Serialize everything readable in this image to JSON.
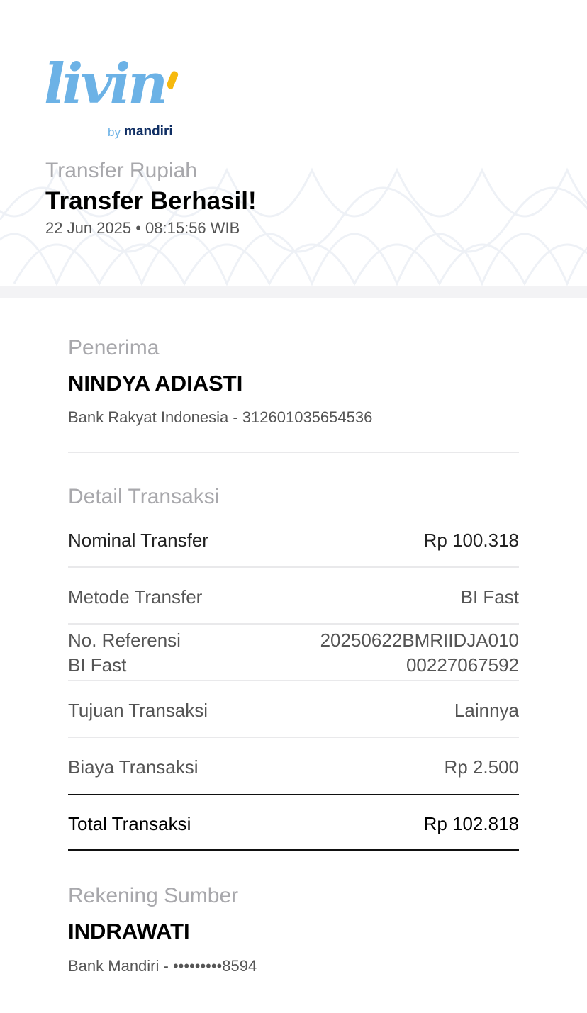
{
  "brand": {
    "logo_word": "livin",
    "logo_by": "by",
    "logo_bank": "mandiri",
    "primary_color": "#6cb2e6",
    "accent_color": "#f6b90e",
    "navy_color": "#0f2e63"
  },
  "header": {
    "category": "Transfer Rupiah",
    "status": "Transfer Berhasil!",
    "datetime": "22 Jun 2025 • 08:15:56 WIB"
  },
  "recipient": {
    "section_label": "Penerima",
    "name": "NINDYA ADIASTI",
    "bank_account": "Bank Rakyat Indonesia - 312601035654536"
  },
  "details": {
    "section_label": "Detail Transaksi",
    "nominal": {
      "label": "Nominal Transfer",
      "value": "Rp 100.318"
    },
    "method": {
      "label": "Metode Transfer",
      "value": "BI Fast"
    },
    "reference": {
      "label_line1": "No. Referensi",
      "label_line2": "BI Fast",
      "value_line1": "20250622BMRIIDJA010",
      "value_line2": "00227067592"
    },
    "purpose": {
      "label": "Tujuan Transaksi",
      "value": "Lainnya"
    },
    "fee": {
      "label": "Biaya Transaksi",
      "value": "Rp 2.500"
    },
    "total": {
      "label": "Total Transaksi",
      "value": "Rp 102.818"
    }
  },
  "source": {
    "section_label": "Rekening Sumber",
    "name": "INDRAWATI",
    "bank_account": "Bank Mandiri - •••••••••8594"
  }
}
